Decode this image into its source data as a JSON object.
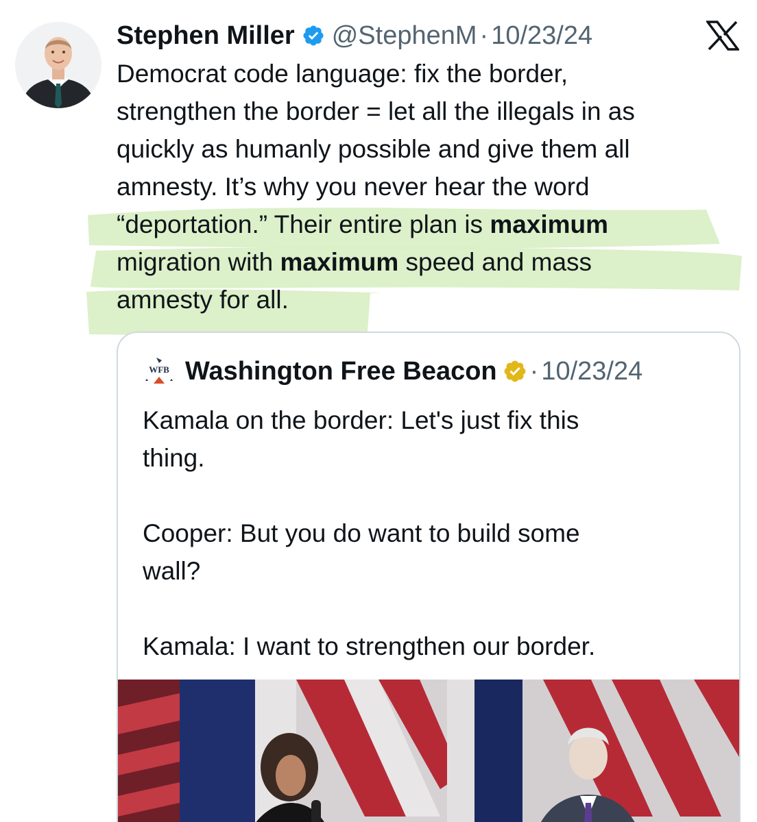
{
  "tweet": {
    "author_name": "Stephen Miller",
    "handle": "@StephenM",
    "separator": "·",
    "date": "10/23/24",
    "lines": [
      {
        "segments": [
          {
            "text": "Democrat code language: fix the border,",
            "bold": false
          }
        ]
      },
      {
        "segments": [
          {
            "text": "strengthen the border = let all the illegals in as",
            "bold": false
          }
        ]
      },
      {
        "segments": [
          {
            "text": "quickly as humanly possible and give them all",
            "bold": false
          }
        ]
      },
      {
        "segments": [
          {
            "text": "amnesty. It’s why you never hear the word",
            "bold": false
          }
        ]
      },
      {
        "segments": [
          {
            "text": "“deportation.” Their entire plan is ",
            "bold": false
          },
          {
            "text": "maximum",
            "bold": true
          }
        ]
      },
      {
        "segments": [
          {
            "text": "migration with ",
            "bold": false
          },
          {
            "text": "maximum",
            "bold": true
          },
          {
            "text": " speed and mass",
            "bold": false
          }
        ]
      },
      {
        "segments": [
          {
            "text": "amnesty for all.",
            "bold": false
          }
        ]
      }
    ],
    "highlight_color": "#d7edc1"
  },
  "quoted": {
    "logo_text": "WFB",
    "author_name": "Washington Free Beacon",
    "separator": "·",
    "date": "10/23/24",
    "paragraphs": [
      [
        "Kamala on the border: Let's just fix this",
        "thing."
      ],
      [
        "Cooper: But you do want to build some",
        "wall?"
      ],
      [
        "Kamala: I want to strengthen our border."
      ]
    ]
  },
  "icons": {
    "verified_blue": "verified-badge-icon",
    "verified_gold": "gold-verified-badge-icon",
    "platform_logo": "x-logo-icon"
  },
  "colors": {
    "text": "#0f1419",
    "secondary": "#536471",
    "blue_badge": "#1d9bf0",
    "gold_badge": "#e2b719",
    "card_border": "#cfd9de"
  }
}
